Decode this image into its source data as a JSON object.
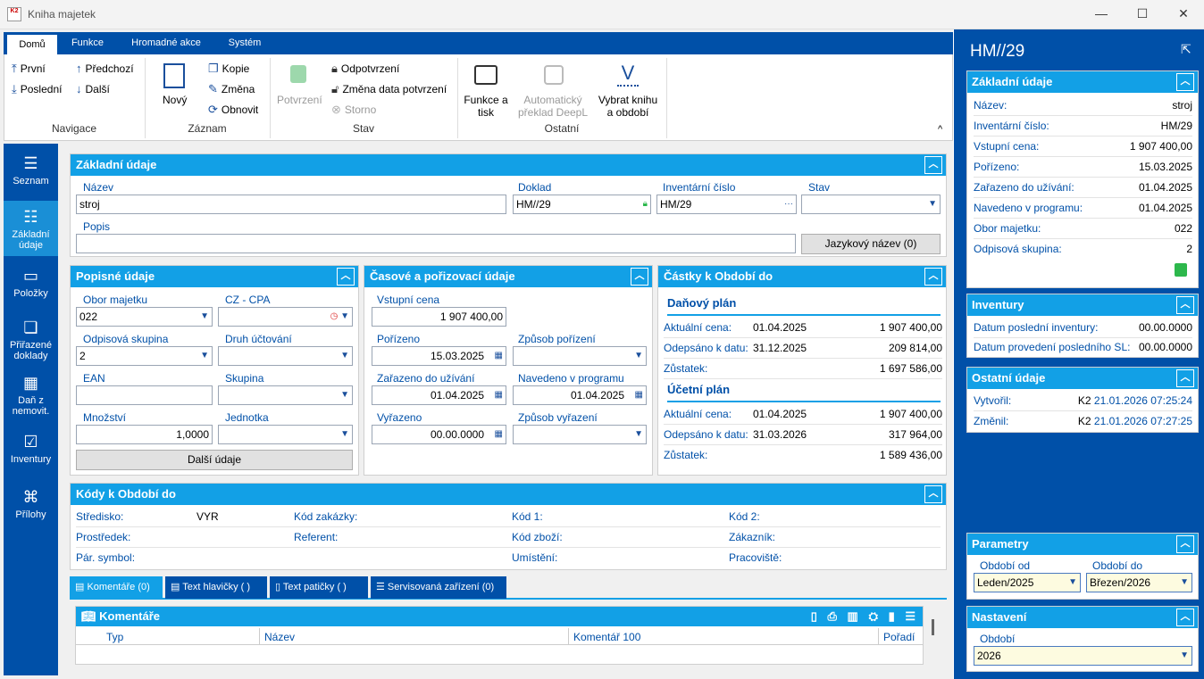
{
  "window": {
    "title": "Kniha majetek",
    "icon_text": "K2",
    "minimize": "—",
    "maximize": "☐",
    "close": "✕"
  },
  "ribbon": {
    "tabs": [
      "Domů",
      "Funkce",
      "Hromadné akce",
      "Systém"
    ],
    "nav": {
      "first": "První",
      "last": "Poslední",
      "prev": "Předchozí",
      "next": "Další",
      "group": "Navigace"
    },
    "record": {
      "new": "Nový",
      "copy": "Kopie",
      "change": "Změna",
      "refresh": "Obnovit",
      "group": "Záznam"
    },
    "state": {
      "confirm": "Potvrzení",
      "unconfirm": "Odpotvrzení",
      "change_date": "Změna data potvrzení",
      "storno": "Storno",
      "group": "Stav"
    },
    "other": {
      "print": "Funkce a tisk",
      "deepl": "Automatický překlad DeepL",
      "book": "Vybrat knihu a období",
      "group": "Ostatní"
    }
  },
  "leftnav": [
    "Seznam",
    "Základní údaje",
    "Položky",
    "Přiřazené doklady",
    "Daň z nemovit.",
    "Inventury",
    "Přílohy"
  ],
  "basic": {
    "title": "Základní údaje",
    "nazev_label": "Název",
    "nazev": "stroj",
    "doklad_label": "Doklad",
    "doklad": "HM//29",
    "inv_label": "Inventární číslo",
    "inv": "HM/29",
    "stav_label": "Stav",
    "stav": "",
    "popis_label": "Popis",
    "popis": "",
    "lang_button": "Jazykový název (0)"
  },
  "descriptive": {
    "title": "Popisné údaje",
    "obor_label": "Obor majetku",
    "obor": "022",
    "cz_label": "CZ - CPA",
    "cz": "",
    "odpis_label": "Odpisová skupina",
    "odpis": "2",
    "druh_label": "Druh účtování",
    "druh": "",
    "ean_label": "EAN",
    "ean": "",
    "skupina_label": "Skupina",
    "skupina": "",
    "mnozstvi_label": "Množství",
    "mnozstvi": "1,0000",
    "jednotka_label": "Jednotka",
    "jednotka": "",
    "more_button": "Další údaje"
  },
  "timing": {
    "title": "Časové a pořizovací údaje",
    "vstupni_label": "Vstupní cena",
    "vstupni": "1 907 400,00",
    "porizeno_label": "Pořízeno",
    "porizeno": "15.03.2025",
    "zpusob_label": "Způsob pořízení",
    "zpusob": "",
    "zarazeno_label": "Zařazeno do užívání",
    "zarazeno": "01.04.2025",
    "navedeno_label": "Navedeno v programu",
    "navedeno": "01.04.2025",
    "vyrazeno_label": "Vyřazeno",
    "vyrazeno": "00.00.0000",
    "zpusob_vyr_label": "Způsob vyřazení",
    "zpusob_vyr": ""
  },
  "amounts": {
    "title": "Částky k Období do",
    "tax_title": "Daňový plán",
    "tax": [
      {
        "k": "Aktuální cena:",
        "d": "01.04.2025",
        "v": "1 907 400,00"
      },
      {
        "k": "Odepsáno k datu:",
        "d": "31.12.2025",
        "v": "209 814,00"
      },
      {
        "k": "Zůstatek:",
        "d": "",
        "v": "1 697 586,00"
      }
    ],
    "acc_title": "Účetní plán",
    "acc": [
      {
        "k": "Aktuální cena:",
        "d": "01.04.2025",
        "v": "1 907 400,00"
      },
      {
        "k": "Odepsáno k datu:",
        "d": "31.03.2026",
        "v": "317 964,00"
      },
      {
        "k": "Zůstatek:",
        "d": "",
        "v": "1 589 436,00"
      }
    ]
  },
  "codes": {
    "title": "Kódy k Období do",
    "stredisko": "Středisko:",
    "stredisko_v": "VYR",
    "zakazka": "Kód zakázky:",
    "kod1": "Kód 1:",
    "kod2": "Kód 2:",
    "prostredek": "Prostředek:",
    "referent": "Referent:",
    "zbozi": "Kód zboží:",
    "zakaznik": "Zákazník:",
    "par": "Pár. symbol:",
    "umisteni": "Umístění:",
    "pracoviste": "Pracoviště:"
  },
  "bottomtabs": [
    "Komentáře (0)",
    "Text hlavičky ( )",
    "Text patičky ( )",
    "Servisovaná zařízení (0)"
  ],
  "comments": {
    "title": "Komentáře",
    "cols": [
      "Typ",
      "Název",
      "Komentář 100",
      "Pořadí"
    ]
  },
  "right": {
    "title": "HM//29",
    "basic_title": "Základní údaje",
    "basic": [
      {
        "k": "Název:",
        "v": "stroj"
      },
      {
        "k": "Inventární číslo:",
        "v": "HM/29"
      },
      {
        "k": "Vstupní cena:",
        "v": "1 907 400,00"
      },
      {
        "k": "Pořízeno:",
        "v": "15.03.2025"
      },
      {
        "k": "Zařazeno do užívání:",
        "v": "01.04.2025"
      },
      {
        "k": "Navedeno v programu:",
        "v": "01.04.2025"
      },
      {
        "k": "Obor majetku:",
        "v": "022"
      },
      {
        "k": "Odpisová skupina:",
        "v": "2"
      }
    ],
    "inv_title": "Inventury",
    "inv": [
      {
        "k": "Datum poslední inventury:",
        "v": "00.00.0000"
      },
      {
        "k": "Datum provedení posledního SL:",
        "v": "00.00.0000"
      }
    ],
    "other_title": "Ostatní údaje",
    "created_k": "Vytvořil:",
    "created_u": "K2",
    "created_d": "21.01.2026 07:25:24",
    "changed_k": "Změnil:",
    "changed_u": "K2",
    "changed_d": "21.01.2026 07:27:25",
    "params_title": "Parametry",
    "od_label": "Období od",
    "od": "Leden/2025",
    "do_label": "Období do",
    "do": "Březen/2026",
    "settings_title": "Nastavení",
    "obdobi_label": "Období",
    "obdobi": "2026"
  }
}
